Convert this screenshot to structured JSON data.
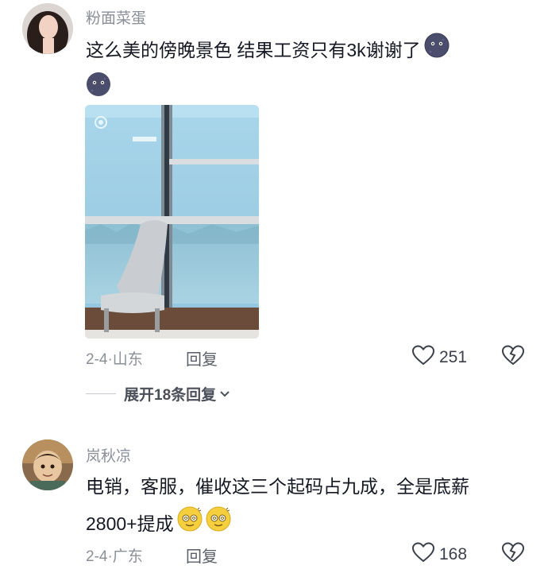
{
  "comments": [
    {
      "username": "粉面菜蛋",
      "text": "这么美的傍晚景色 结果工资只有3k谢谢了",
      "emoji": "moon-face",
      "date": "2-4",
      "location": "山东",
      "reply_label": "回复",
      "likes": "251",
      "expand_label": "展开18条回复"
    },
    {
      "username": "岚秋凉",
      "text_line1": "电销，客服，催收这三个起码占九成，全是底薪",
      "text_line2": "2800+提成",
      "emoji": "dizzy-face",
      "date": "2-4",
      "location": "广东",
      "reply_label": "回复",
      "likes": "168"
    }
  ],
  "meta_separator": "·",
  "colors": {
    "text": "#161823",
    "muted": "#8b8f98",
    "window_blue": "#a9d6ea"
  }
}
